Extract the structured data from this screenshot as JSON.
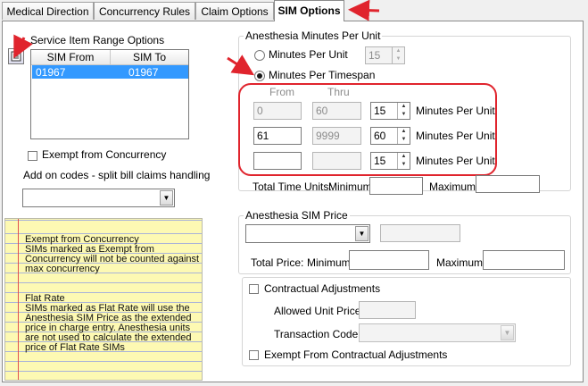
{
  "tabs": [
    {
      "label": "Medical Direction"
    },
    {
      "label": "Concurrency Rules"
    },
    {
      "label": "Claim Options"
    },
    {
      "label": "SIM Options"
    }
  ],
  "service_range": {
    "title": "Service Item Range Options",
    "col_from": "SIM From",
    "col_to": "SIM To",
    "rows": [
      {
        "from": "01967",
        "to": "01967"
      }
    ]
  },
  "exempt_concurrency": {
    "label": "Exempt from Concurrency",
    "checked": false
  },
  "addon": {
    "label": "Add on codes - split bill claims handling",
    "value": ""
  },
  "note": {
    "lines_a": [
      "Exempt from Concurrency",
      "SIMs marked as Exempt from",
      "Concurrency will not be counted against",
      "max concurrency"
    ],
    "lines_b": [
      "Flat Rate",
      "SIMs marked as Flat Rate will use the",
      "Anesthesia SIM Price as the extended",
      "price in charge entry. Anesthesia units",
      "are not used to calculate the extended",
      "price of Flat Rate SIMs"
    ]
  },
  "anesthesia_minutes": {
    "title": "Anesthesia Minutes Per Unit",
    "mpu_label": "Minutes Per Unit",
    "mpu_value": "15",
    "timespan_label": "Minutes Per Timespan",
    "from_header": "From",
    "thru_header": "Thru",
    "rows": [
      {
        "from": "0",
        "thru": "60",
        "minutes": "15",
        "unit_label": "Minutes Per Unit"
      },
      {
        "from": "61",
        "thru": "9999",
        "minutes": "60",
        "unit_label": "Minutes Per Unit"
      },
      {
        "from": "",
        "thru": "",
        "minutes": "15",
        "unit_label": "Minutes Per Unit"
      }
    ],
    "total_label": "Total Time Units:",
    "minimum_label": "Minimum",
    "maximum_label": "Maximum",
    "minimum_value": "",
    "maximum_value": ""
  },
  "sim_price": {
    "title": "Anesthesia SIM Price",
    "combo_value": "",
    "price_value": "",
    "total_label": "Total Price:",
    "minimum_label": "Minimum",
    "maximum_label": "Maximum",
    "minimum_value": "",
    "maximum_value": ""
  },
  "contractual": {
    "label": "Contractual Adjustments",
    "allowed_label": "Allowed Unit Price",
    "allowed_value": "",
    "txn_label": "Transaction Code",
    "txn_value": "",
    "exempt_label": "Exempt From Contractual Adjustments"
  },
  "colors": {
    "annotation": "#e0242d",
    "selection": "#3399ff",
    "note_bg": "#fdf9b3"
  }
}
